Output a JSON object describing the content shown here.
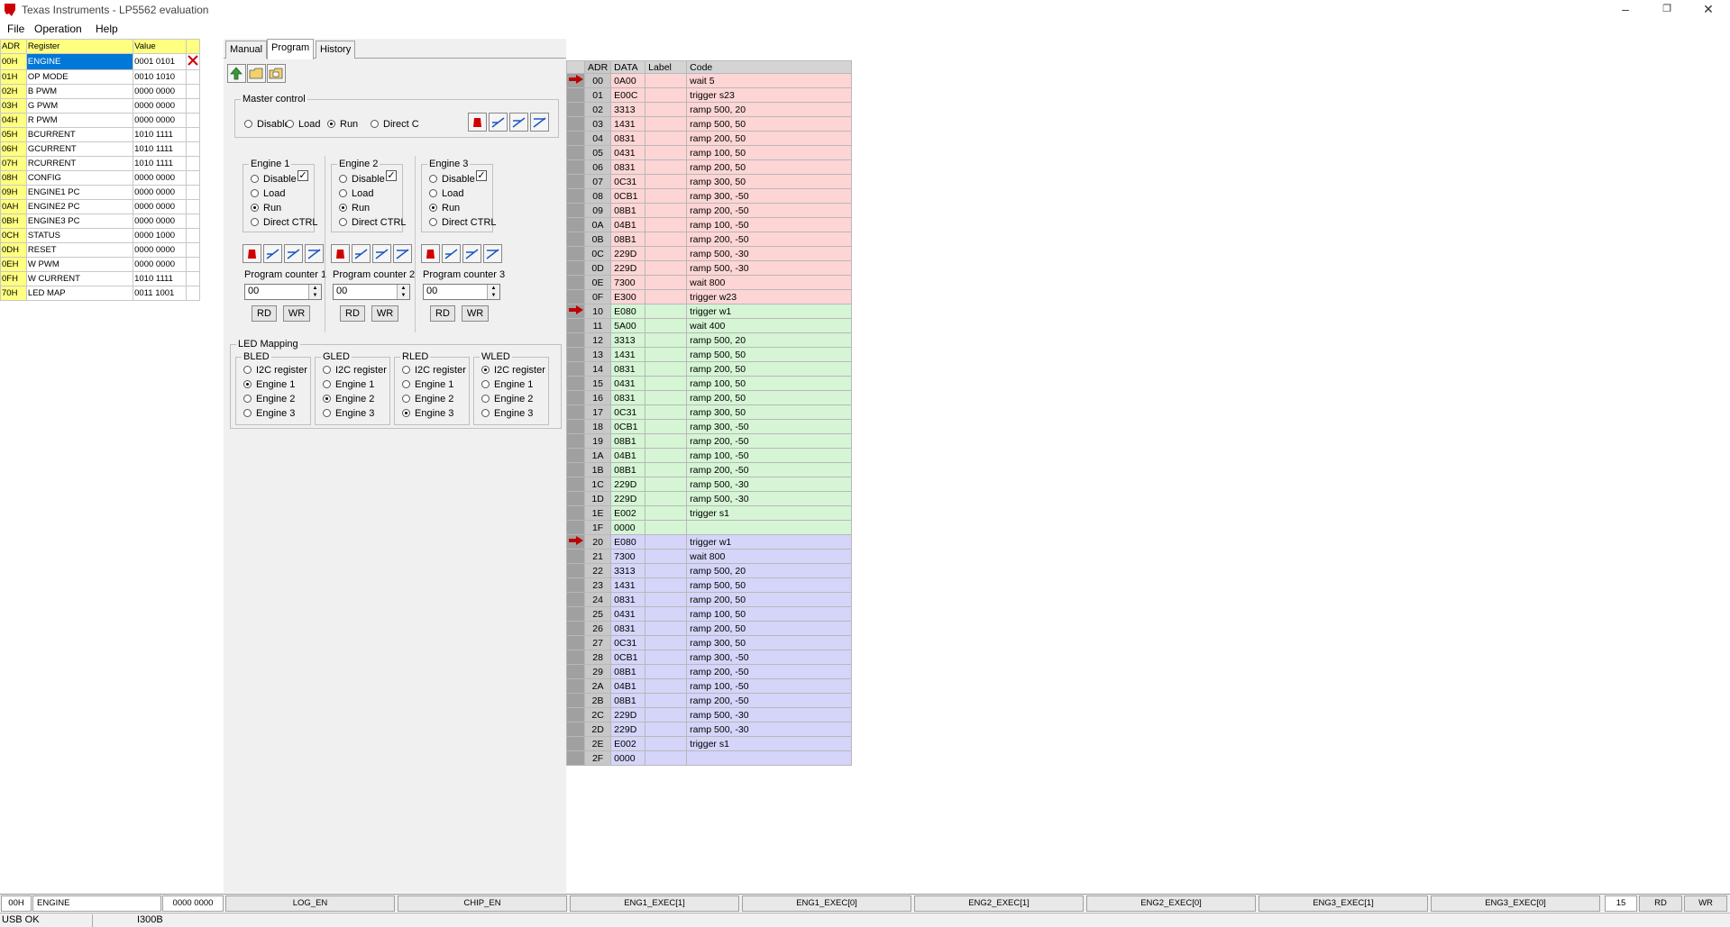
{
  "window": {
    "title": "Texas Instruments - LP5562 evaluation"
  },
  "menu": [
    "File",
    "Operation",
    "Help"
  ],
  "registers": {
    "headers": [
      "ADR",
      "Register",
      "Value"
    ],
    "rows": [
      [
        "00H",
        "ENGINE",
        "0001 0101"
      ],
      [
        "01H",
        "OP MODE",
        "0010 1010"
      ],
      [
        "02H",
        "B PWM",
        "0000 0000"
      ],
      [
        "03H",
        "G PWM",
        "0000 0000"
      ],
      [
        "04H",
        "R PWM",
        "0000 0000"
      ],
      [
        "05H",
        "BCURRENT",
        "1010 1111"
      ],
      [
        "06H",
        "GCURRENT",
        "1010 1111"
      ],
      [
        "07H",
        "RCURRENT",
        "1010 1111"
      ],
      [
        "08H",
        "CONFIG",
        "0000 0000"
      ],
      [
        "09H",
        "ENGINE1 PC",
        "0000 0000"
      ],
      [
        "0AH",
        "ENGINE2 PC",
        "0000 0000"
      ],
      [
        "0BH",
        "ENGINE3 PC",
        "0000 0000"
      ],
      [
        "0CH",
        "STATUS",
        "0000 1000"
      ],
      [
        "0DH",
        "RESET",
        "0000 0000"
      ],
      [
        "0EH",
        "W PWM",
        "0000 0000"
      ],
      [
        "0FH",
        "W CURRENT",
        "1010 1111"
      ],
      [
        "70H",
        "LED MAP",
        "0011 1001"
      ]
    ]
  },
  "tabs": [
    "Manual",
    "Program",
    "History"
  ],
  "master": {
    "title": "Master control",
    "options": [
      "Disable",
      "Load",
      "Run",
      "Direct C"
    ],
    "selected": 2
  },
  "engines": [
    {
      "title": "Engine 1",
      "options": [
        "Disable",
        "Load",
        "Run",
        "Direct CTRL"
      ],
      "selected": 2,
      "pc_label": "Program counter 1",
      "pc_value": "00",
      "rd": "RD",
      "wr": "WR"
    },
    {
      "title": "Engine 2",
      "options": [
        "Disable",
        "Load",
        "Run",
        "Direct CTRL"
      ],
      "selected": 2,
      "pc_label": "Program counter 2",
      "pc_value": "00",
      "rd": "RD",
      "wr": "WR"
    },
    {
      "title": "Engine 3",
      "options": [
        "Disable",
        "Load",
        "Run",
        "Direct CTRL"
      ],
      "selected": 2,
      "pc_label": "Program counter 3",
      "pc_value": "00",
      "rd": "RD",
      "wr": "WR"
    }
  ],
  "led_mapping": {
    "title": "LED Mapping",
    "groups": [
      {
        "title": "BLED",
        "options": [
          "I2C register",
          "Engine 1",
          "Engine 2",
          "Engine 3"
        ],
        "selected": 1
      },
      {
        "title": "GLED",
        "options": [
          "I2C register",
          "Engine 1",
          "Engine 2",
          "Engine 3"
        ],
        "selected": 2
      },
      {
        "title": "RLED",
        "options": [
          "I2C register",
          "Engine 1",
          "Engine 2",
          "Engine 3"
        ],
        "selected": 3
      },
      {
        "title": "WLED",
        "options": [
          "I2C register",
          "Engine 1",
          "Engine 2",
          "Engine 3"
        ],
        "selected": 0
      }
    ]
  },
  "program": {
    "headers": [
      "ADR",
      "DATA",
      "Label",
      "Code"
    ],
    "rows": [
      [
        "00",
        "0A00",
        "",
        "wait 5"
      ],
      [
        "01",
        "E00C",
        "",
        "trigger s23"
      ],
      [
        "02",
        "3313",
        "",
        "ramp  500, 20"
      ],
      [
        "03",
        "1431",
        "",
        "ramp  500, 50"
      ],
      [
        "04",
        "0831",
        "",
        "ramp  200, 50"
      ],
      [
        "05",
        "0431",
        "",
        "ramp  100, 50"
      ],
      [
        "06",
        "0831",
        "",
        "ramp  200, 50"
      ],
      [
        "07",
        "0C31",
        "",
        "ramp  300, 50"
      ],
      [
        "08",
        "0CB1",
        "",
        "ramp  300, -50"
      ],
      [
        "09",
        "08B1",
        "",
        "ramp  200, -50"
      ],
      [
        "0A",
        "04B1",
        "",
        "ramp  100, -50"
      ],
      [
        "0B",
        "08B1",
        "",
        "ramp  200, -50"
      ],
      [
        "0C",
        "229D",
        "",
        "ramp  500, -30"
      ],
      [
        "0D",
        "229D",
        "",
        "ramp  500, -30"
      ],
      [
        "0E",
        "7300",
        "",
        "wait 800"
      ],
      [
        "0F",
        "E300",
        "",
        "trigger w23"
      ],
      [
        "10",
        "E080",
        "",
        "trigger w1"
      ],
      [
        "11",
        "5A00",
        "",
        "wait 400"
      ],
      [
        "12",
        "3313",
        "",
        "ramp  500, 20"
      ],
      [
        "13",
        "1431",
        "",
        "ramp  500, 50"
      ],
      [
        "14",
        "0831",
        "",
        "ramp  200, 50"
      ],
      [
        "15",
        "0431",
        "",
        "ramp  100, 50"
      ],
      [
        "16",
        "0831",
        "",
        "ramp  200, 50"
      ],
      [
        "17",
        "0C31",
        "",
        "ramp  300, 50"
      ],
      [
        "18",
        "0CB1",
        "",
        "ramp  300, -50"
      ],
      [
        "19",
        "08B1",
        "",
        "ramp  200, -50"
      ],
      [
        "1A",
        "04B1",
        "",
        "ramp  100, -50"
      ],
      [
        "1B",
        "08B1",
        "",
        "ramp  200, -50"
      ],
      [
        "1C",
        "229D",
        "",
        "ramp  500, -30"
      ],
      [
        "1D",
        "229D",
        "",
        "ramp  500, -30"
      ],
      [
        "1E",
        "E002",
        "",
        "trigger s1"
      ],
      [
        "1F",
        "0000",
        "",
        ""
      ],
      [
        "20",
        "E080",
        "",
        "trigger w1"
      ],
      [
        "21",
        "7300",
        "",
        "wait 800"
      ],
      [
        "22",
        "3313",
        "",
        "ramp  500, 20"
      ],
      [
        "23",
        "1431",
        "",
        "ramp  500, 50"
      ],
      [
        "24",
        "0831",
        "",
        "ramp  200, 50"
      ],
      [
        "25",
        "0431",
        "",
        "ramp  100, 50"
      ],
      [
        "26",
        "0831",
        "",
        "ramp  200, 50"
      ],
      [
        "27",
        "0C31",
        "",
        "ramp  300, 50"
      ],
      [
        "28",
        "0CB1",
        "",
        "ramp  300, -50"
      ],
      [
        "29",
        "08B1",
        "",
        "ramp  200, -50"
      ],
      [
        "2A",
        "04B1",
        "",
        "ramp  100, -50"
      ],
      [
        "2B",
        "08B1",
        "",
        "ramp  200, -50"
      ],
      [
        "2C",
        "229D",
        "",
        "ramp  500, -30"
      ],
      [
        "2D",
        "229D",
        "",
        "ramp  500, -30"
      ],
      [
        "2E",
        "E002",
        "",
        "trigger s1"
      ],
      [
        "2F",
        "0000",
        "",
        ""
      ]
    ],
    "pointers": [
      "00",
      "10",
      "20"
    ],
    "colors": {
      "engine1": "#fdd5d5",
      "engine2": "#d5f5d5",
      "engine3": "#d5d5fa"
    }
  },
  "bitbar": {
    "adr": "00H",
    "register": "ENGINE",
    "value": "0000 0000",
    "bits": [
      "LOG_EN",
      "CHIP_EN",
      "ENG1_EXEC[1]",
      "ENG1_EXEC[0]",
      "ENG2_EXEC[1]",
      "ENG2_EXEC[0]",
      "ENG3_EXEC[1]",
      "ENG3_EXEC[0]"
    ],
    "num": "15",
    "rd": "RD",
    "wr": "WR"
  },
  "status": {
    "usb": "USB OK",
    "device": "I300B"
  }
}
